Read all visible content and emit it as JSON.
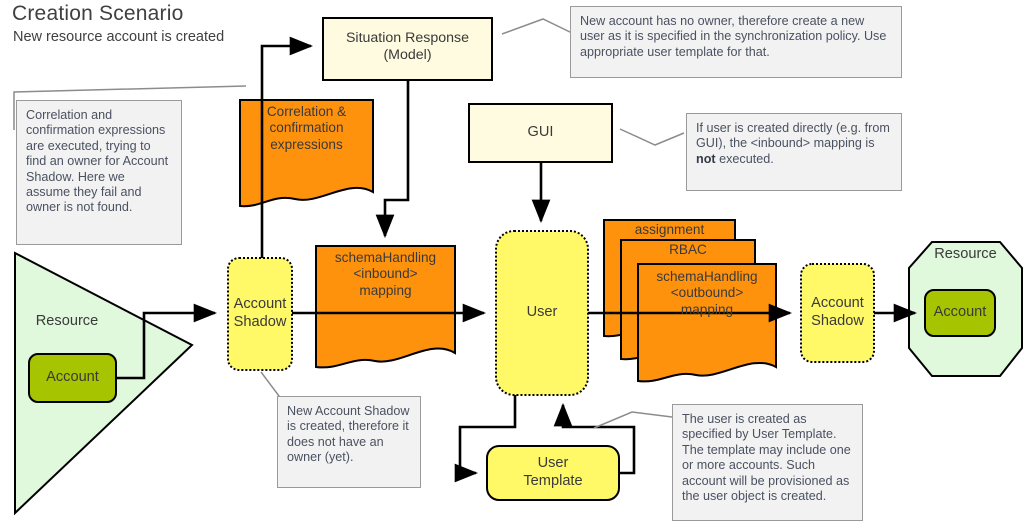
{
  "title": {
    "main": "Creation Scenario",
    "subtitle": "New resource account is created"
  },
  "notes": [
    {
      "id": "note-correlation",
      "text": "Correlation and confirmation expressions are executed, trying to find an owner for Account Shadow. Here we assume they fail and owner is not found."
    },
    {
      "id": "note-new-account",
      "text": "New account has no owner, therefore create a new user as it is specified in the synchronization policy. Use appropriate user template for that."
    },
    {
      "id": "note-gui",
      "text_before": "If user is created directly (e.g. from GUI), the <inbound> mapping is ",
      "text_bold": "not",
      "text_after": " executed."
    },
    {
      "id": "note-shadow",
      "text": "New Account Shadow is created, therefore it does not have an owner (yet)."
    },
    {
      "id": "note-user-template",
      "text": "The user is created as specified by User Template. The template may include one or more accounts. Such account will be provisioned as the user object is created."
    }
  ],
  "nodes": {
    "situation_response": "Situation Response\n(Model)",
    "gui": "GUI",
    "correlation_doc": "Correlation &\nconfirmation\nexpressions",
    "inbound_doc": "schemaHandling\n<inbound>\nmapping",
    "assignment_doc": "assignment",
    "rbac_doc": "RBAC",
    "outbound_doc": "schemaHandling\n<outbound>\nmapping",
    "account_shadow_left": "Account\nShadow",
    "account_shadow_right": "Account\nShadow",
    "user": "User",
    "user_template": "User\nTemplate",
    "resource_left": "Resource",
    "resource_right": "Resource",
    "account_left": "Account",
    "account_right": "Account"
  },
  "colors": {
    "orange": "#FF920D",
    "yellow": "#FFF968",
    "cream": "#FFFBE0",
    "green_light": "#E0F8DC",
    "green_dark": "#A6C400",
    "note_bg": "#F2F2F2",
    "note_border": "#9A9A9A",
    "stroke": "#000000",
    "leader": "#8C8C8C"
  }
}
